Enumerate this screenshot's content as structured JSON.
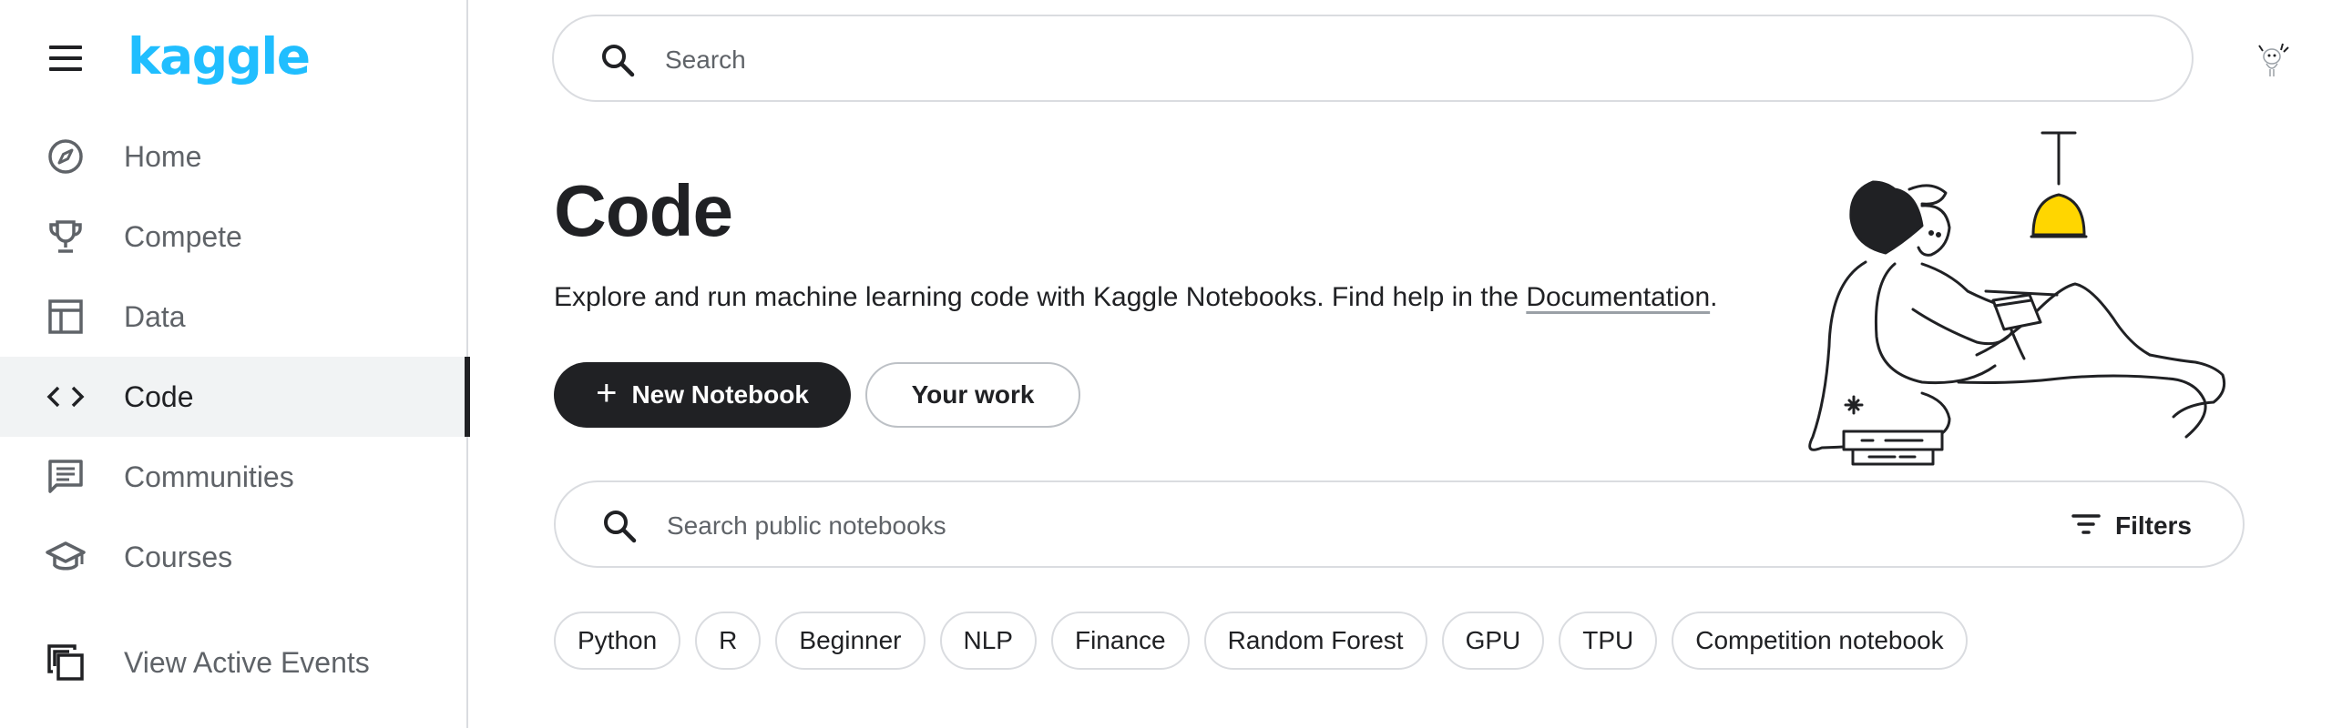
{
  "sidebar": {
    "logo": "kaggle",
    "items": [
      {
        "label": "Home",
        "icon": "compass-icon"
      },
      {
        "label": "Compete",
        "icon": "trophy-icon"
      },
      {
        "label": "Data",
        "icon": "table-icon"
      },
      {
        "label": "Code",
        "icon": "code-icon",
        "active": true
      },
      {
        "label": "Communities",
        "icon": "comment-icon"
      },
      {
        "label": "Courses",
        "icon": "school-icon"
      }
    ],
    "events_label": "View Active Events"
  },
  "header": {
    "search_placeholder": "Search"
  },
  "main": {
    "title": "Code",
    "subtitle_text": "Explore and run machine learning code with Kaggle Notebooks. Find help in the ",
    "subtitle_link": "Documentation",
    "subtitle_end": ".",
    "new_notebook_label": "New Notebook",
    "your_work_label": "Your work",
    "notebook_search_placeholder": "Search public notebooks",
    "filters_label": "Filters",
    "chips": [
      "Python",
      "R",
      "Beginner",
      "NLP",
      "Finance",
      "Random Forest",
      "GPU",
      "TPU",
      "Competition notebook"
    ]
  },
  "colors": {
    "brand": "#20beff",
    "primary_button": "#202124",
    "lamp": "#ffd600"
  }
}
